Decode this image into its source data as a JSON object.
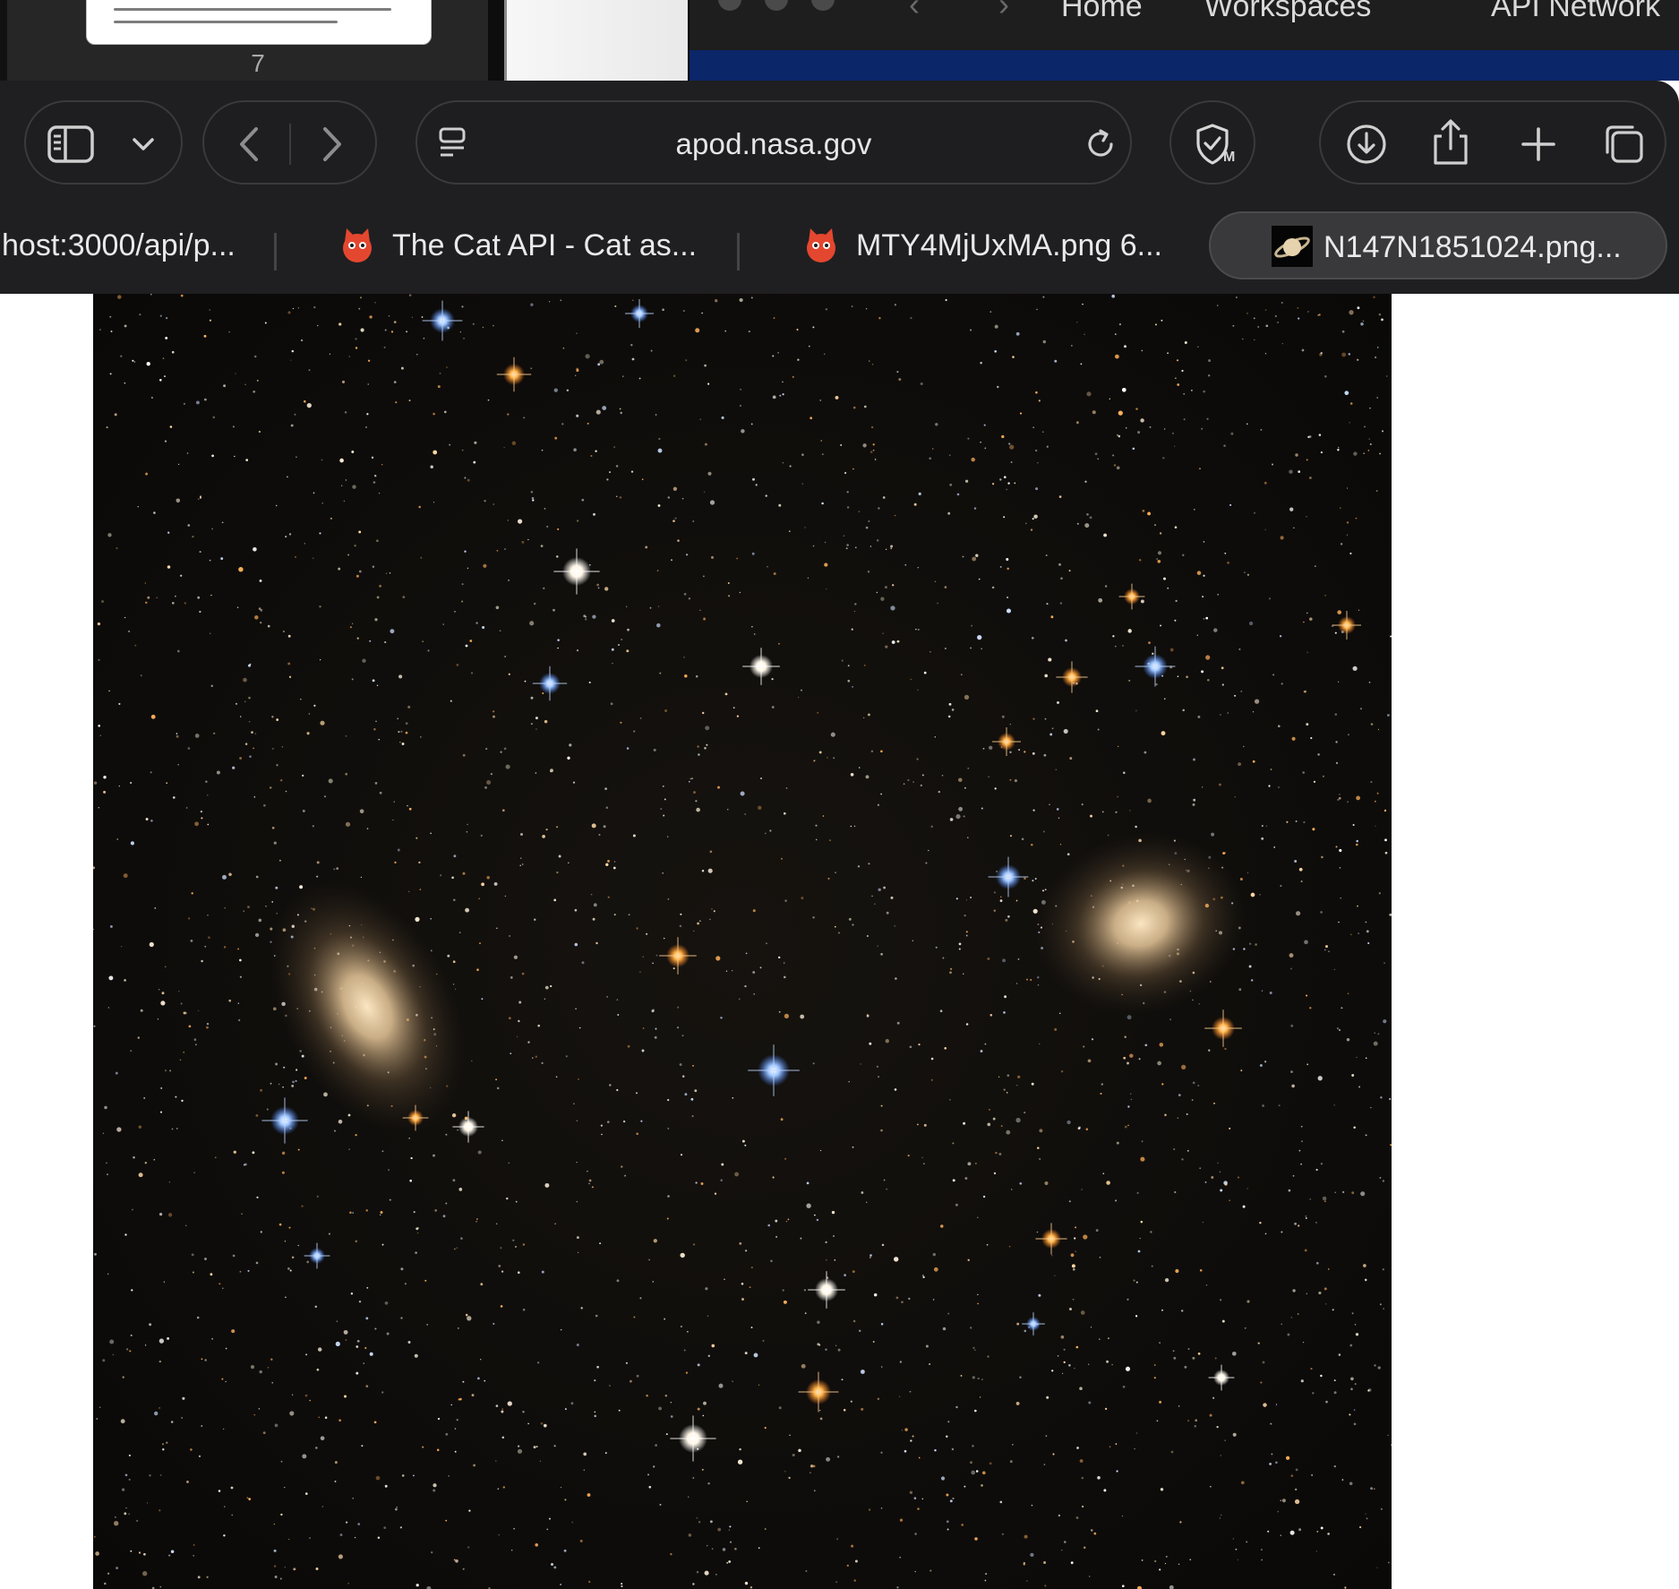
{
  "background_windows": {
    "document_page_number": "7",
    "postman_nav": {
      "home_label": "Home",
      "workspaces_label": "Workspaces",
      "api_network_label": "API Network"
    }
  },
  "toolbar": {
    "address": "apod.nasa.gov"
  },
  "tabs": [
    {
      "title": "host:3000/api/p...",
      "favicon": "none",
      "active": false
    },
    {
      "title": "The Cat API - Cat as...",
      "favicon": "cat-api-icon",
      "active": false
    },
    {
      "title": "MTY4MjUxMA.png 6...",
      "favicon": "cat-api-icon",
      "active": false
    },
    {
      "title": "N147N1851024.png...",
      "favicon": "saturn-icon",
      "active": true
    }
  ],
  "page": {
    "image_description": "deep-field astronomy image with two elliptical galaxies"
  },
  "colors": {
    "chrome_bg": "#1f1f21",
    "active_tab_bg": "#39393b",
    "space_bg": "#0c0b09",
    "galaxy_core": "#f0cfa2",
    "postman_blue": "#0b2769"
  }
}
